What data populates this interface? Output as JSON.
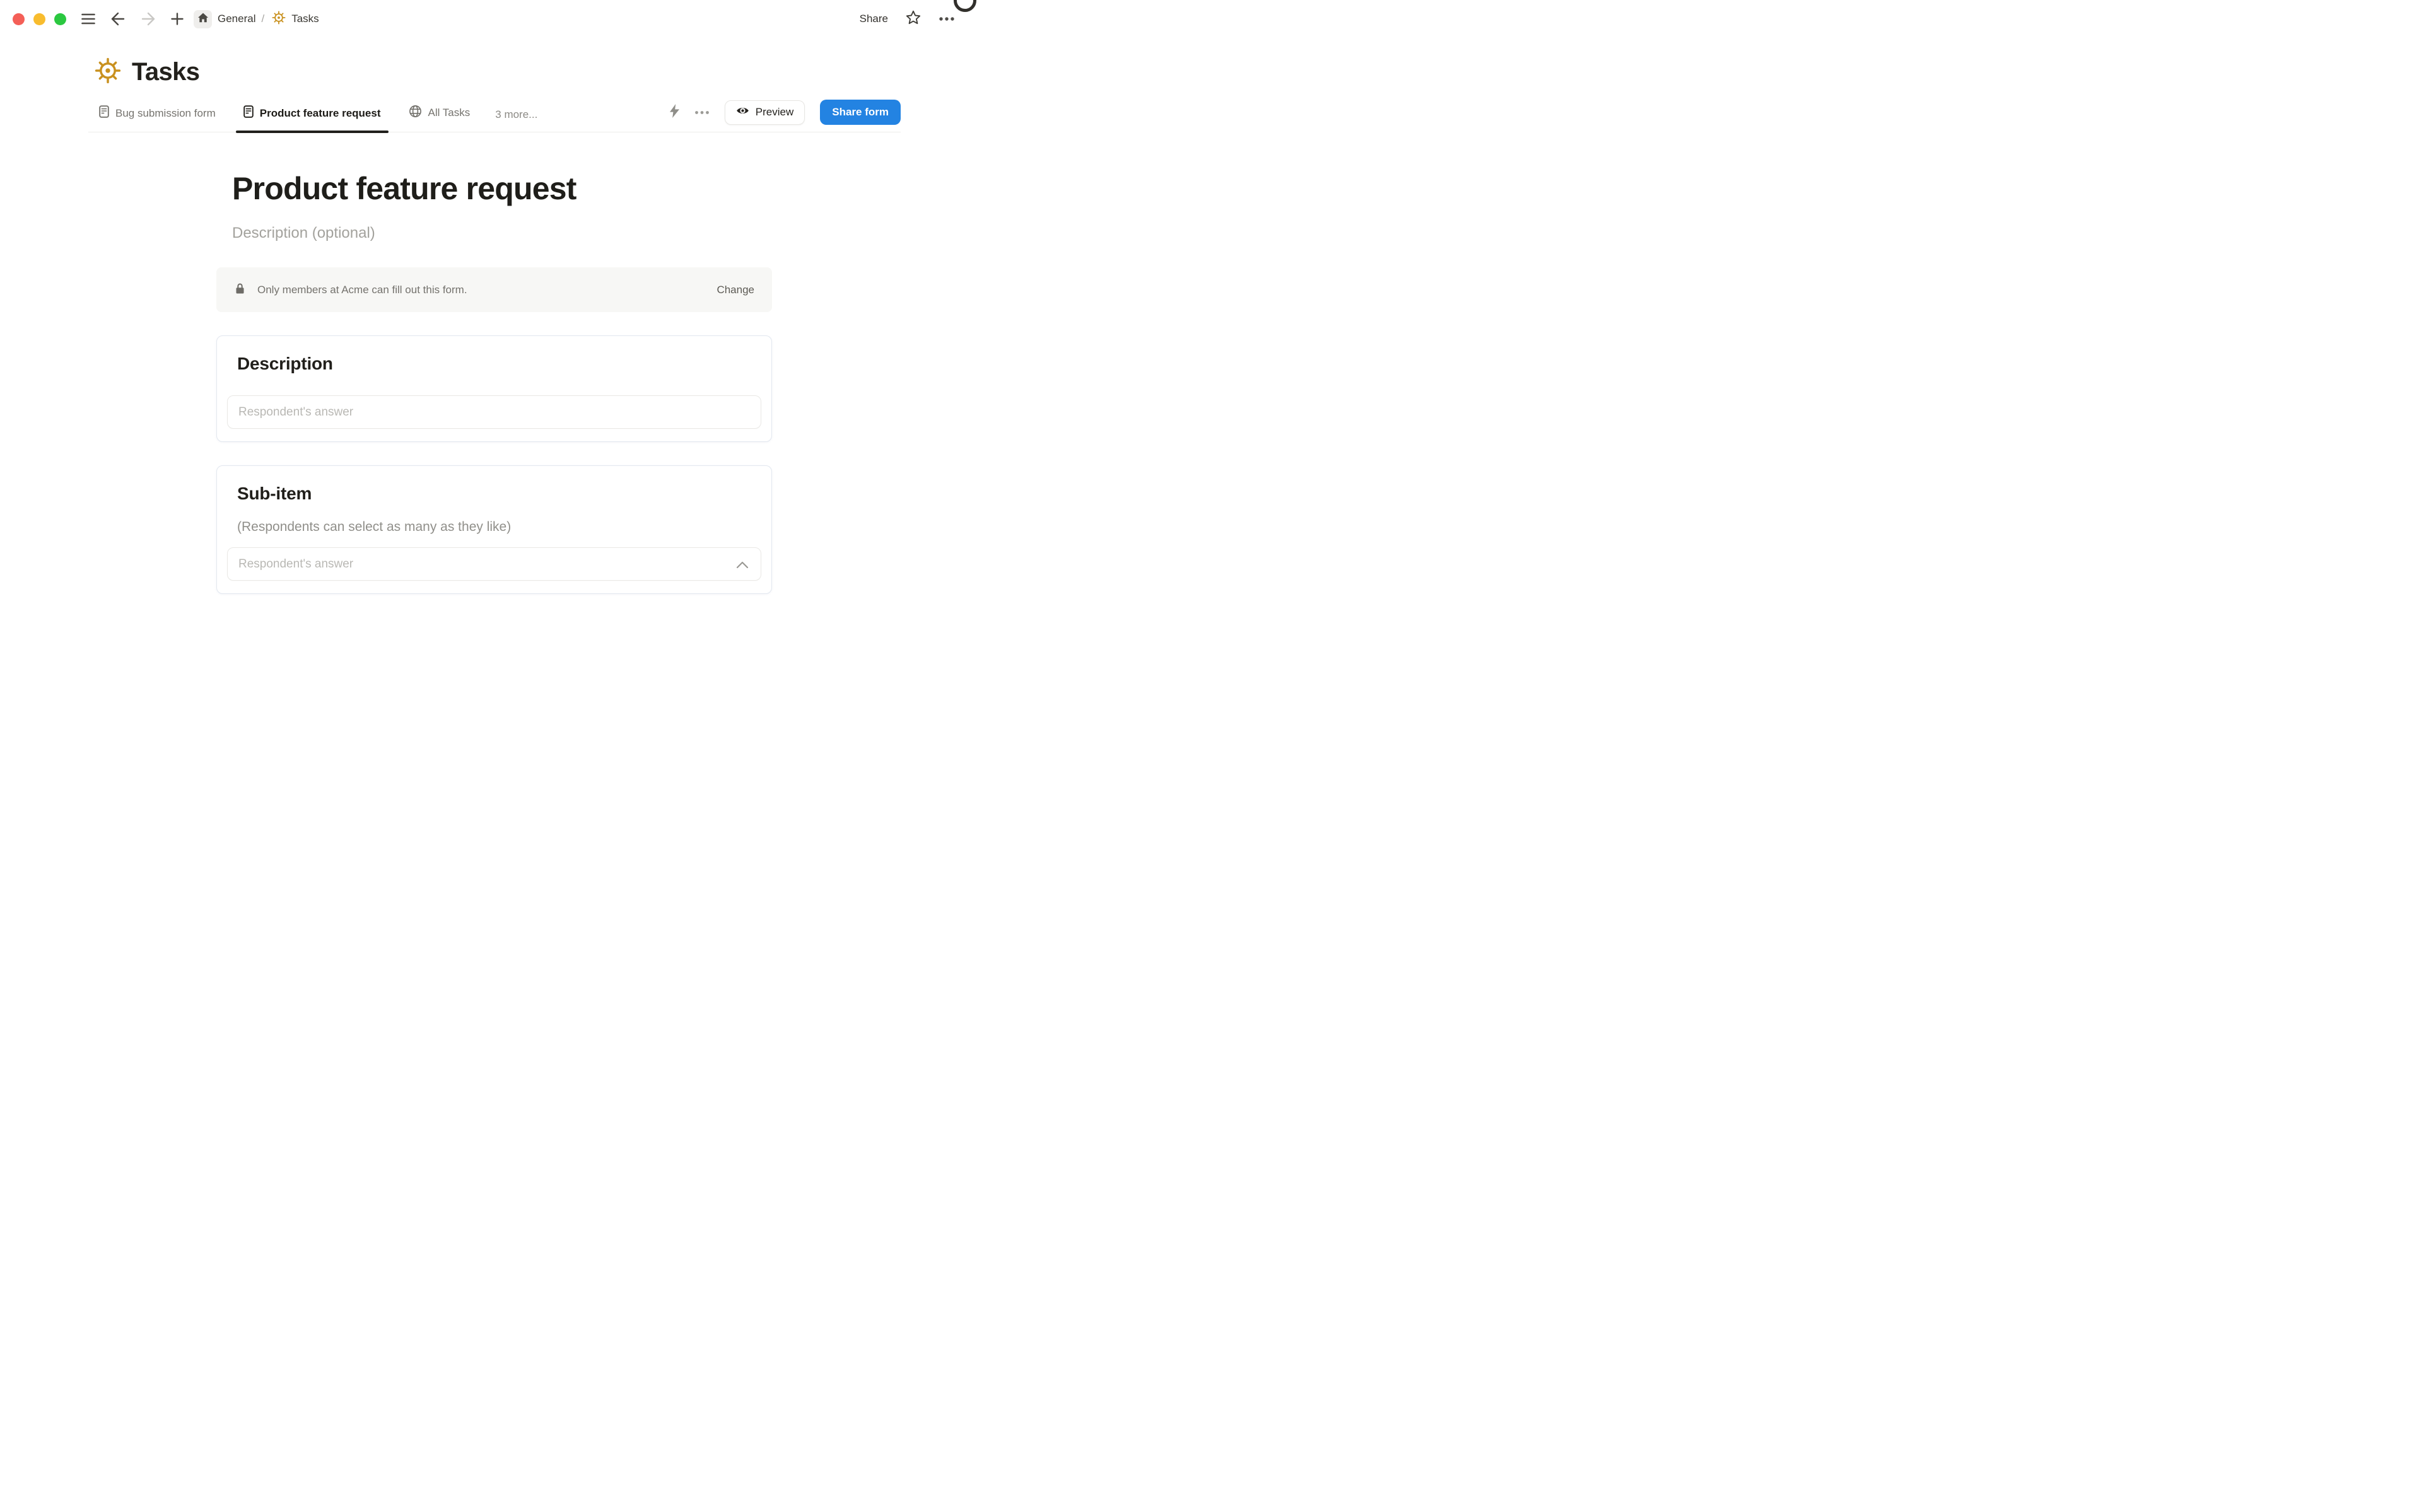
{
  "window": {
    "traffic_lights": [
      "close",
      "minimize",
      "zoom"
    ],
    "breadcrumb": {
      "root": "General",
      "separator": "/",
      "page": "Tasks"
    },
    "share_label": "Share"
  },
  "page": {
    "title": "Tasks"
  },
  "tabs": {
    "items": [
      {
        "label": "Bug submission form",
        "icon": "form-doc-icon",
        "active": false
      },
      {
        "label": "Product feature request",
        "icon": "form-doc-icon",
        "active": true
      },
      {
        "label": "All Tasks",
        "icon": "globe-icon",
        "active": false
      }
    ],
    "more_label": "3 more..."
  },
  "actions": {
    "preview_label": "Preview",
    "share_form_label": "Share form"
  },
  "form": {
    "title": "Product feature request",
    "description_placeholder": "Description (optional)",
    "access_notice": {
      "text": "Only members at Acme can fill out this form.",
      "action_label": "Change"
    },
    "fields": [
      {
        "label": "Description",
        "placeholder": "Respondent's answer"
      },
      {
        "label": "Sub-item",
        "hint": "(Respondents can select as many as they like)",
        "placeholder": "Respondent's answer"
      }
    ]
  },
  "icons": {
    "page_icon": "ship-helm",
    "helm_color": "#c9911f",
    "accent_blue": "#2383e2"
  }
}
